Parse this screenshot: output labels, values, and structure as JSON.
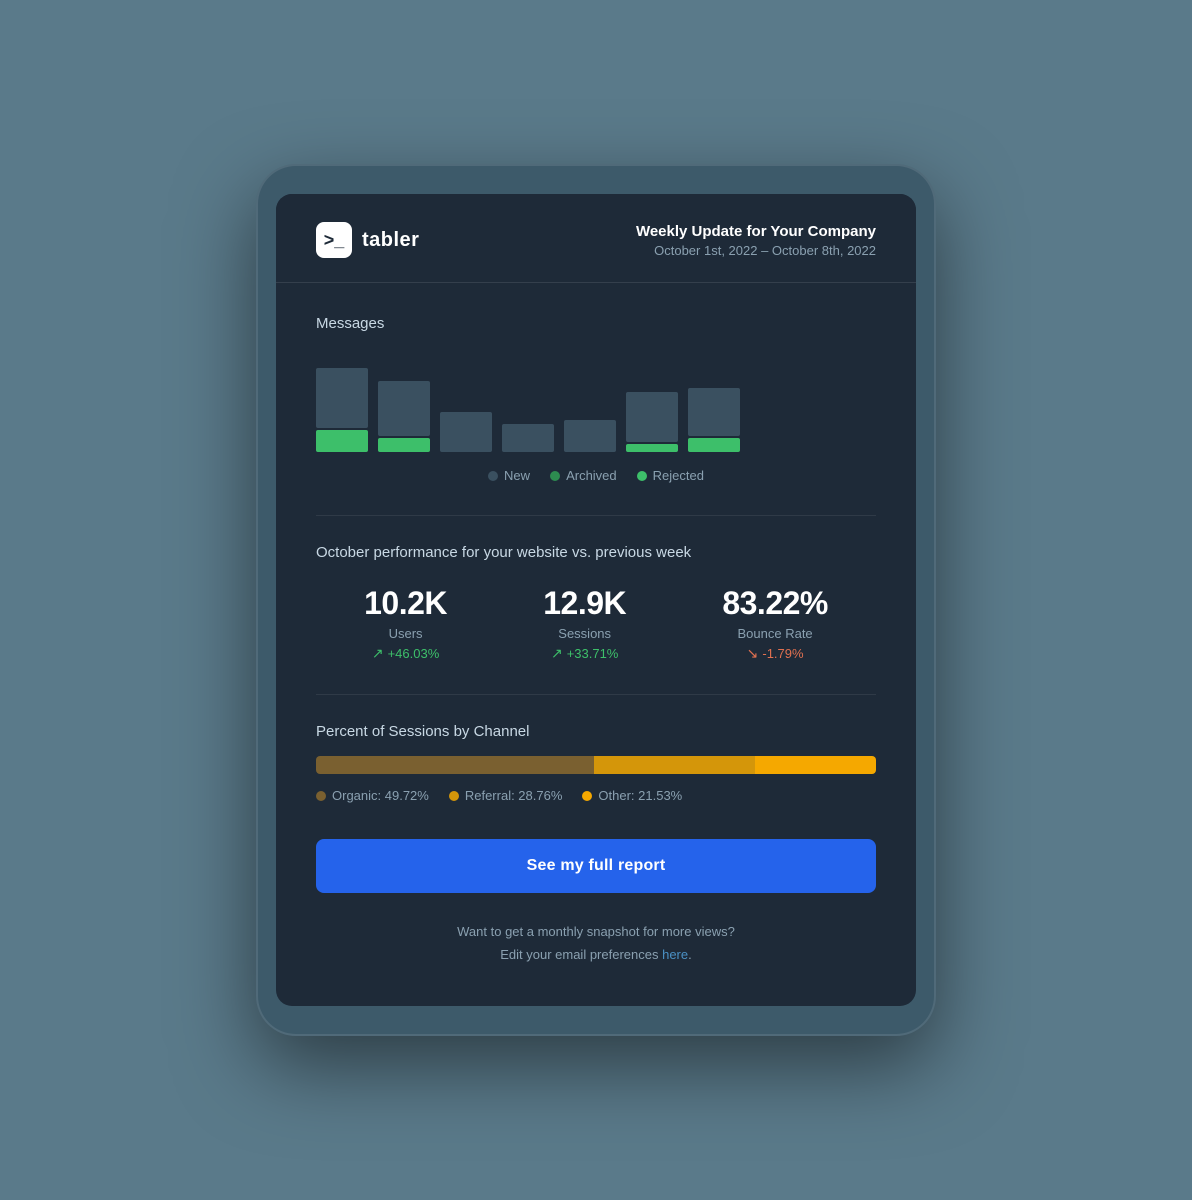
{
  "logo": {
    "icon": ">_",
    "name": "tabler"
  },
  "header": {
    "title": "Weekly Update for Your Company",
    "date": "October 1st, 2022 – October 8th, 2022"
  },
  "messages": {
    "section_title": "Messages",
    "chart": {
      "bars": [
        {
          "new": 60,
          "archived": 0,
          "rejected": 22
        },
        {
          "new": 55,
          "archived": 0,
          "rejected": 14
        },
        {
          "new": 40,
          "archived": 0,
          "rejected": 0
        },
        {
          "new": 28,
          "archived": 0,
          "rejected": 0
        },
        {
          "new": 32,
          "archived": 0,
          "rejected": 0
        },
        {
          "new": 50,
          "archived": 0,
          "rejected": 8
        },
        {
          "new": 48,
          "archived": 0,
          "rejected": 14
        }
      ]
    },
    "legend": {
      "new": "New",
      "archived": "Archived",
      "rejected": "Rejected"
    }
  },
  "performance": {
    "section_title": "October performance for your website vs. previous week",
    "metrics": [
      {
        "value": "10.2K",
        "label": "Users",
        "change": "+46.03%",
        "positive": true
      },
      {
        "value": "12.9K",
        "label": "Sessions",
        "change": "+33.71%",
        "positive": true
      },
      {
        "value": "83.22%",
        "label": "Bounce Rate",
        "change": "-1.79%",
        "positive": false
      }
    ]
  },
  "sessions_channel": {
    "section_title": "Percent of Sessions by Channel",
    "segments": [
      {
        "label": "Organic",
        "percent": 49.72,
        "color": "organic"
      },
      {
        "label": "Referral",
        "percent": 28.76,
        "color": "referral"
      },
      {
        "label": "Other",
        "percent": 21.53,
        "color": "other"
      }
    ],
    "legend": [
      {
        "label": "Organic: 49.72%",
        "color": "organic"
      },
      {
        "label": "Referral: 28.76%",
        "color": "referral"
      },
      {
        "label": "Other: 21.53%",
        "color": "other"
      }
    ]
  },
  "cta": {
    "label": "See my full report"
  },
  "footer": {
    "line1": "Want to get a monthly snapshot for more views?",
    "line2_prefix": "Edit your email preferences ",
    "link_text": "here",
    "line2_suffix": "."
  }
}
